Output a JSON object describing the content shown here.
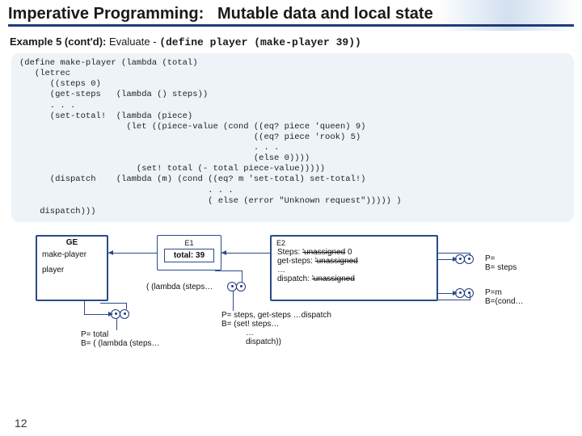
{
  "header": {
    "title_left": "Imperative Programming:",
    "title_right": "Mutable data and local state"
  },
  "example": {
    "label": "Example 5 (cont'd):",
    "desc": "Evaluate -",
    "code": "(define player (make-player 39))"
  },
  "code_block": "(define make-player (lambda (total)\n   (letrec\n      ((steps 0)\n      (get-steps   (lambda () steps))\n      . . .\n      (set-total!  (lambda (piece)\n                     (let ((piece-value (cond ((eq? piece 'queen) 9)\n                                              ((eq? piece 'rook) 5)\n                                              . . .\n                                              (else 0))))\n                       (set! total (- total piece-value)))))\n      (dispatch    (lambda (m) (cond ((eq? m 'set-total) set-total!)\n                                     . . .\n                                     ( else (error \"Unknown request\"))))) )\n    dispatch)))",
  "diagram": {
    "ge": {
      "name": "GE",
      "items": [
        "make-player",
        "player"
      ]
    },
    "e1": {
      "name": "E1",
      "line1": "total: 39"
    },
    "e2": {
      "name": "E2",
      "line1": "Steps:",
      "line1_old": "'unassigned",
      "line1_new": "0",
      "line2": "get-steps:",
      "line2_old": "'unassigned",
      "line3": "…",
      "line4": "dispatch:",
      "line4_old": "'unassigned"
    },
    "bottom_left": {
      "p": "P= total",
      "b": "B= ( (lambda (steps…"
    },
    "middle": {
      "body1": "( (lambda (steps…"
    },
    "center": {
      "p": "P= steps, get-steps …dispatch",
      "b": "B= (set! steps…",
      "c": "…",
      "d": "dispatch))"
    },
    "right1": {
      "p": "P=",
      "b": "B= steps"
    },
    "right2": {
      "p": "P=m",
      "b": "B=(cond…"
    }
  },
  "page_number": "12"
}
